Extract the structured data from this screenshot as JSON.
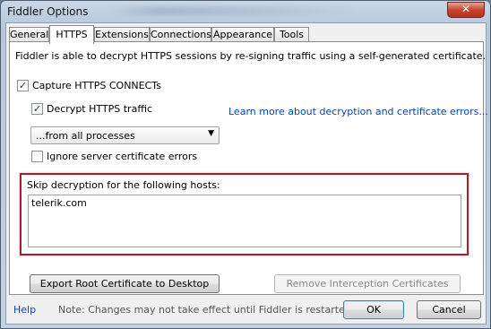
{
  "window": {
    "title": "Fiddler Options",
    "close_glyph": "✕"
  },
  "tabs": [
    {
      "label": "General"
    },
    {
      "label": "HTTPS"
    },
    {
      "label": "Extensions"
    },
    {
      "label": "Connections"
    },
    {
      "label": "Appearance"
    },
    {
      "label": "Tools"
    }
  ],
  "https": {
    "description": "Fiddler is able to decrypt HTTPS sessions by re-signing traffic using a self-generated certificate.",
    "capture_label": "Capture HTTPS CONNECTs",
    "capture_checked": true,
    "decrypt_label": "Decrypt HTTPS traffic",
    "decrypt_checked": true,
    "learn_more_link": "Learn more about decryption and certificate errors...",
    "process_select_value": "...from all processes",
    "ignore_errors_label": "Ignore server certificate errors",
    "ignore_errors_checked": false,
    "skip_label": "Skip decryption for the following hosts:",
    "skip_hosts_value": "telerik.com",
    "export_button": "Export Root Certificate to Desktop",
    "remove_button": "Remove Interception Certificates",
    "check_glyph": "✓"
  },
  "footer": {
    "help_link": "Help",
    "note": "Note: Changes may not take effect until Fiddler is restarted.",
    "ok_button": "OK",
    "cancel_button": "Cancel"
  },
  "colors": {
    "highlight_border": "#a5202d",
    "link": "#0645ad"
  }
}
